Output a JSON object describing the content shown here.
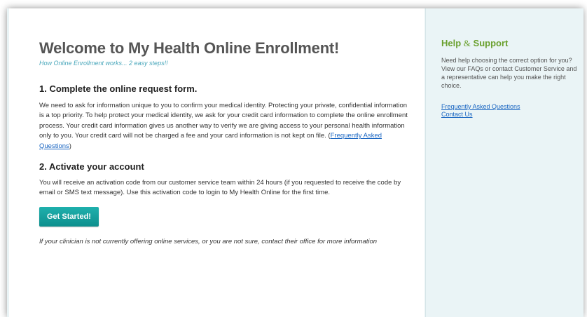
{
  "main": {
    "title": "Welcome to My Health Online Enrollment!",
    "subtitle": "How Online Enrollment works... 2 easy steps!!",
    "step1": {
      "heading": "1. Complete the online request form.",
      "body": "We need to ask for information unique to you to confirm your medical identity. Protecting your private, confidential information is a top priority. To help protect your medical identity, we ask for your credit card information to complete the online enrollment process. Your credit card information gives us another way to verify we are giving access to your personal health information only to you. Your credit card will not be charged a fee and your card information is not kept on file. (",
      "link": "Frequently Asked Questions",
      "body_end": ")"
    },
    "step2": {
      "heading": "2. Activate your account",
      "body": "You will receive an activation code from our customer service team within 24 hours (if you requested to receive the code by email or SMS text message). Use this activation code to login to My Health Online for the first time."
    },
    "button_label": "Get Started!",
    "note": "If your clinician is not currently offering online services, or you are not sure, contact their office for more information"
  },
  "sidebar": {
    "title_part1": "Help",
    "title_amp": "&",
    "title_part2": "Support",
    "text": "Need help choosing the correct option for you? View our FAQs or contact Customer Service and a representative can help you make the right choice.",
    "links": [
      "Frequently Asked Questions",
      "Contact Us"
    ]
  },
  "colors": {
    "accent_button": "#0f9896",
    "sidebar_title": "#6aa02e",
    "subtitle": "#4aa7bb",
    "link": "#1a66c2",
    "sidebar_bg": "#eaf4f6"
  }
}
